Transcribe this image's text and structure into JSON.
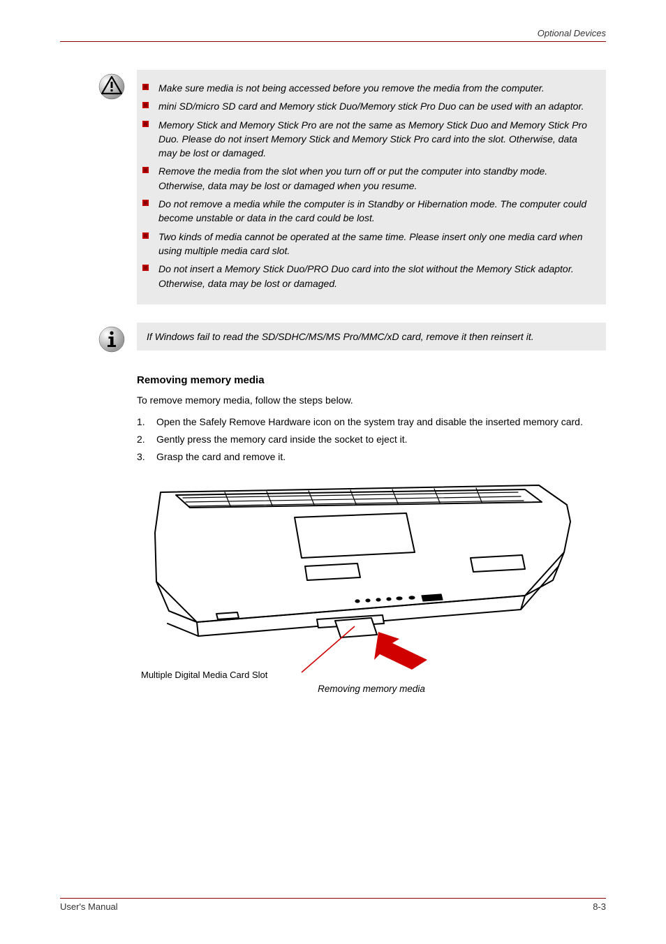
{
  "header": {
    "title": "Optional Devices"
  },
  "warning": {
    "items": [
      "Make sure media is not being accessed before you remove the media from the computer.",
      "mini SD/micro SD card and Memory stick Duo/Memory stick Pro Duo can be used with an adaptor.",
      "Memory Stick and Memory Stick Pro are not the same as Memory Stick Duo and Memory Stick Pro Duo. Please do not insert Memory Stick and Memory Stick Pro card into the slot. Otherwise, data may be lost or damaged.",
      "Remove the media from the slot when you turn off or put the computer into standby mode. Otherwise, data may be lost or damaged when you resume.",
      "Do not remove a media while the computer is in Standby or Hibernation mode. The computer could become unstable or data in the card could be lost.",
      "Two kinds of media cannot be operated at the same time. Please insert only one media card when using multiple media card slot.",
      "Do not insert a Memory Stick Duo/PRO Duo card into the slot without the Memory Stick adaptor. Otherwise, data may be lost or damaged."
    ]
  },
  "info": {
    "text": "If Windows fail to read the SD/SDHC/MS/MS Pro/MMC/xD card, remove it then reinsert it."
  },
  "section": {
    "heading": "Removing memory media",
    "para": "To remove memory media, follow the steps below.",
    "steps": [
      "Open the Safely Remove Hardware icon on the system tray and disable the inserted memory card.",
      "Gently press the memory card inside the socket to eject it.",
      "Grasp the card and remove it."
    ]
  },
  "figure": {
    "label": "Multiple Digital Media Card Slot",
    "caption": "Removing memory media"
  },
  "footer": {
    "left": "User's Manual",
    "right": "8-3"
  }
}
